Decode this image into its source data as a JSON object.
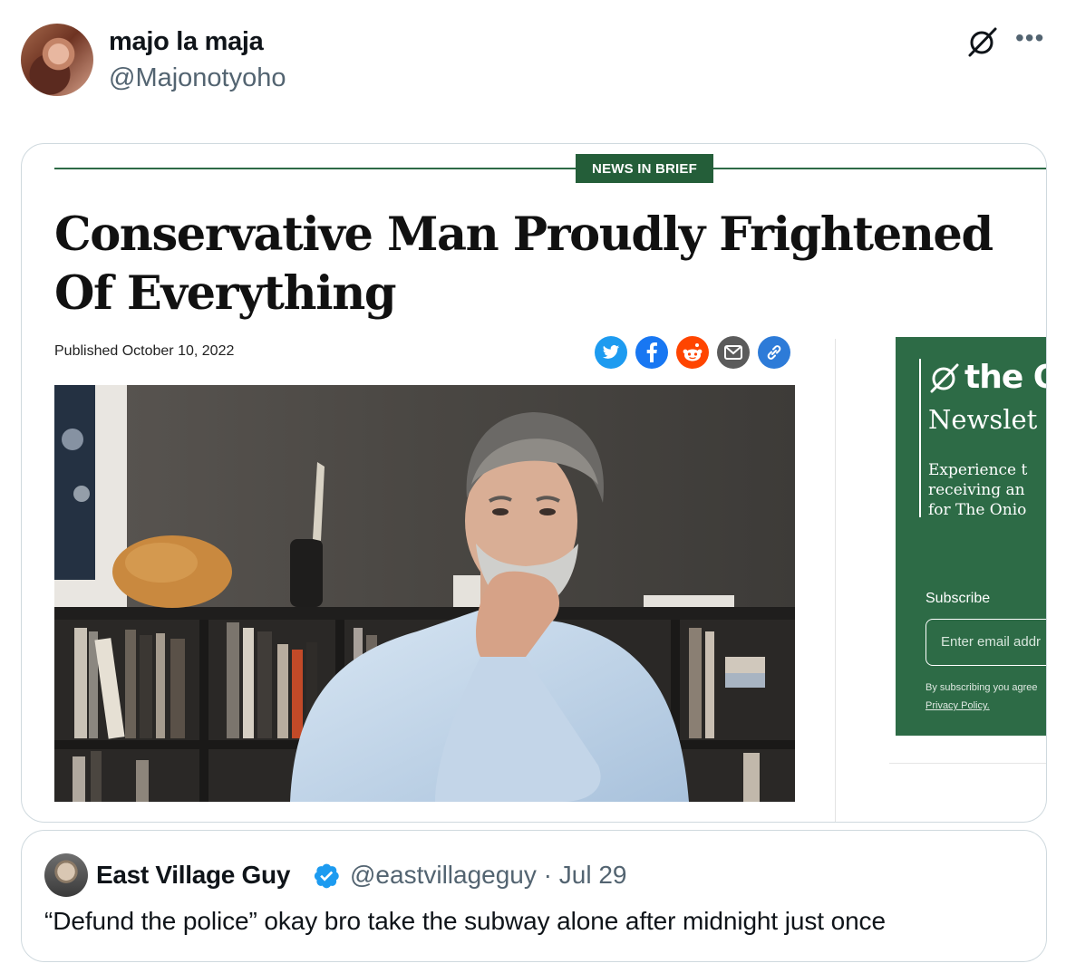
{
  "tweet": {
    "author_name": "majo la maja",
    "author_handle": "@Majonotyoho"
  },
  "article": {
    "kicker": "NEWS IN BRIEF",
    "headline": "Conservative Man Proudly Frightened Of Everything",
    "published": "Published October 10, 2022",
    "share_icons": [
      "twitter-icon",
      "facebook-icon",
      "reddit-icon",
      "email-icon",
      "link-icon"
    ],
    "newsletter": {
      "logo": "the O",
      "title": "Newslet",
      "description": [
        "Experience t",
        "receiving an",
        "for The Onio"
      ],
      "subscribe_label": "Subscribe",
      "email_placeholder": "Enter email addr",
      "terms": "By subscribing you agree",
      "privacy": "Privacy Policy."
    },
    "colors": {
      "brand_green": "#245e39",
      "panel_green": "#2d6b46"
    }
  },
  "quoted_tweet": {
    "name": "East Village Guy",
    "handle_meta": "@eastvillageguy · Jul 29",
    "text": "“Defund the police” okay bro take the subway alone after midnight just once"
  }
}
